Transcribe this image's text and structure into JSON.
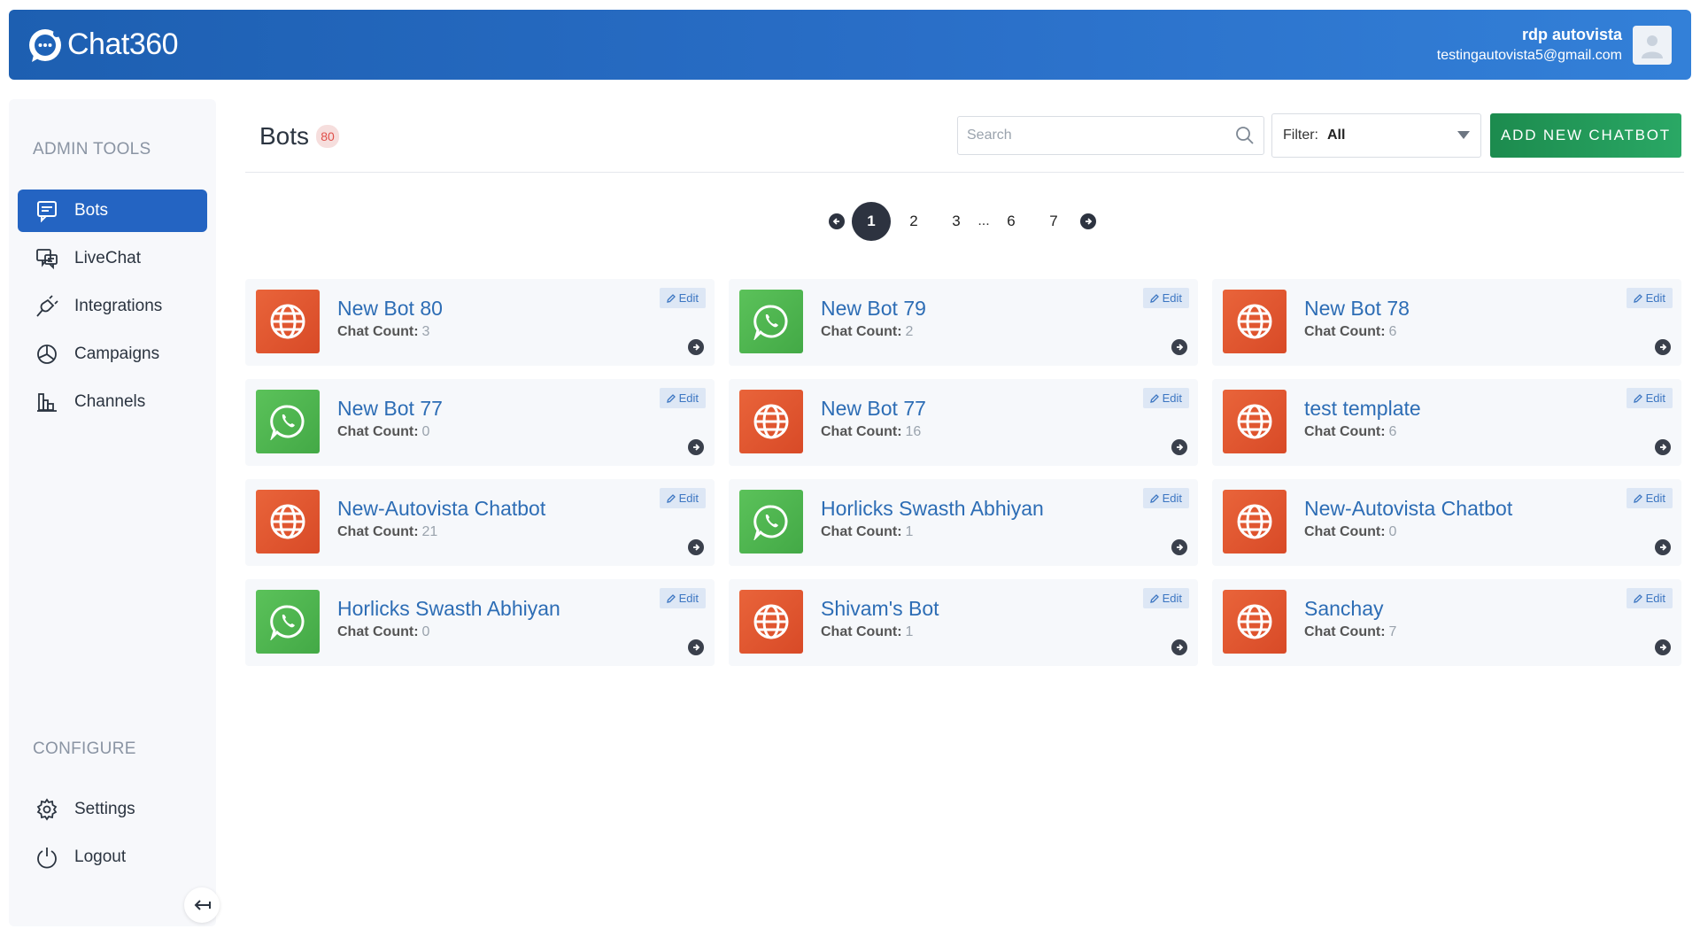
{
  "header": {
    "logo_text": "Chat360",
    "user_name": "rdp autovista",
    "user_email": "testingautovista5@gmail.com"
  },
  "sidebar": {
    "admin_title": "ADMIN TOOLS",
    "items": [
      {
        "label": "Bots",
        "icon": "chat-square-icon",
        "active": true
      },
      {
        "label": "LiveChat",
        "icon": "livechat-icon",
        "active": false
      },
      {
        "label": "Integrations",
        "icon": "plug-icon",
        "active": false
      },
      {
        "label": "Campaigns",
        "icon": "pie-chart-icon",
        "active": false
      },
      {
        "label": "Channels",
        "icon": "bar-chart-icon",
        "active": false
      }
    ],
    "configure_title": "CONFIGURE",
    "config_items": [
      {
        "label": "Settings",
        "icon": "gear-icon"
      },
      {
        "label": "Logout",
        "icon": "power-icon"
      }
    ]
  },
  "main": {
    "title": "Bots",
    "count": "80",
    "search_placeholder": "Search",
    "filter_label": "Filter:",
    "filter_value": "All",
    "add_button": "ADD NEW CHATBOT",
    "pagination": {
      "pages": [
        "1",
        "2",
        "3",
        "6",
        "7"
      ],
      "current": "1",
      "ellipsis": "..."
    },
    "edit_label": "Edit",
    "count_label": "Chat Count:",
    "bots": [
      {
        "name": "New Bot 80",
        "count": "3",
        "channel": "web"
      },
      {
        "name": "New Bot 79",
        "count": "2",
        "channel": "whatsapp"
      },
      {
        "name": "New Bot 78",
        "count": "6",
        "channel": "web"
      },
      {
        "name": "New Bot 77",
        "count": "0",
        "channel": "whatsapp"
      },
      {
        "name": "New Bot 77",
        "count": "16",
        "channel": "web"
      },
      {
        "name": "test template",
        "count": "6",
        "channel": "web"
      },
      {
        "name": "New-Autovista Chatbot",
        "count": "21",
        "channel": "web"
      },
      {
        "name": "Horlicks Swasth Abhiyan",
        "count": "1",
        "channel": "whatsapp"
      },
      {
        "name": "New-Autovista Chatbot",
        "count": "0",
        "channel": "web"
      },
      {
        "name": "Horlicks Swasth Abhiyan",
        "count": "0",
        "channel": "whatsapp"
      },
      {
        "name": "Shivam's Bot",
        "count": "1",
        "channel": "web"
      },
      {
        "name": "Sanchay",
        "count": "7",
        "channel": "web"
      }
    ]
  }
}
